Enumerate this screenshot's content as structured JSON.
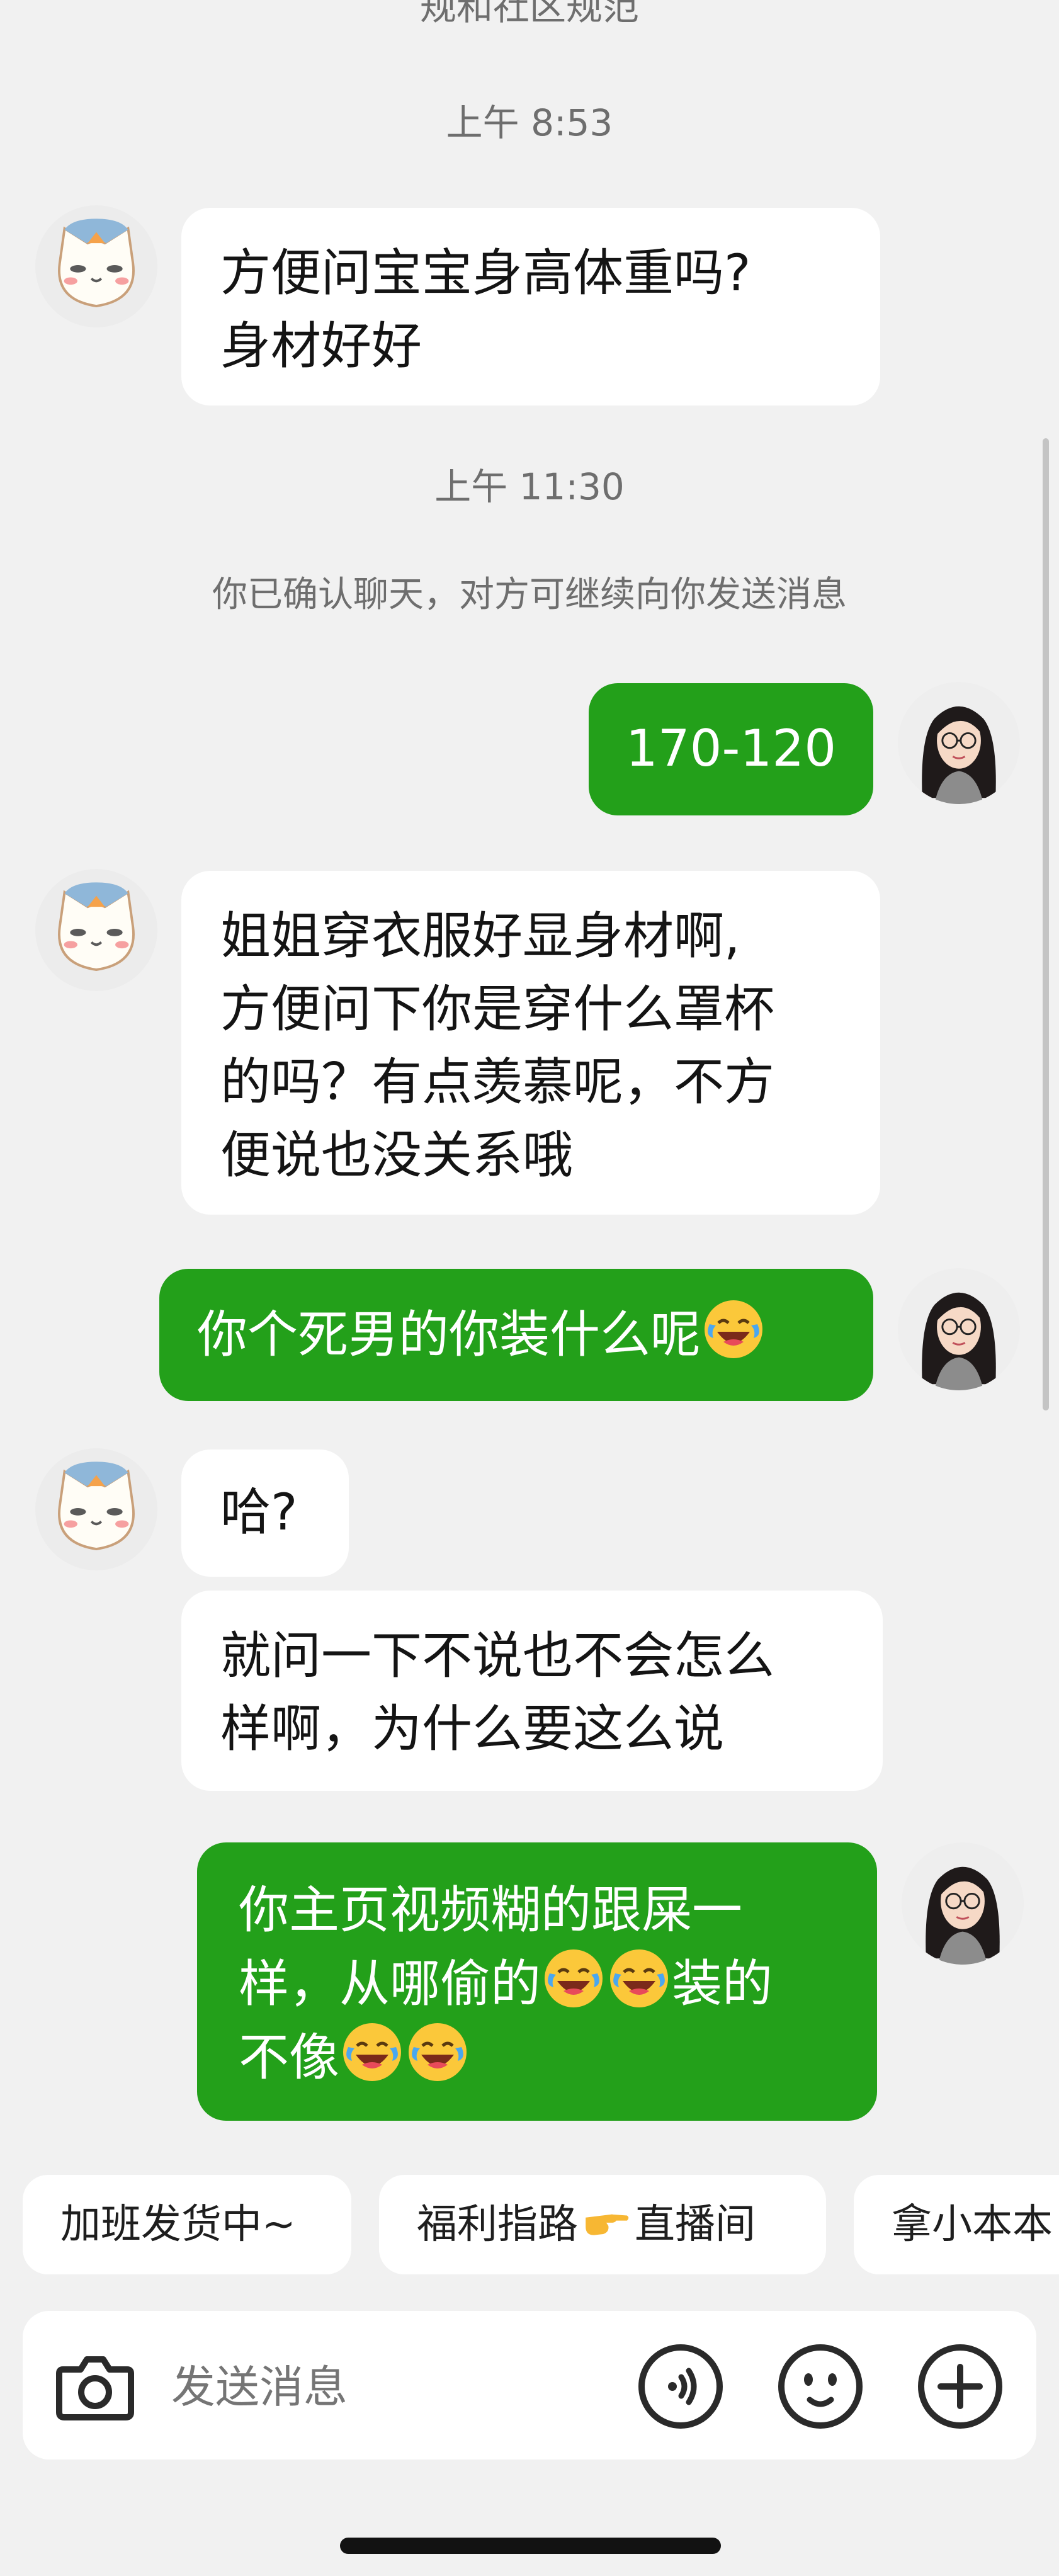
{
  "header": {
    "partial_text": "规和社区规范"
  },
  "timestamps": [
    "上午 8:53",
    "上午 11:30"
  ],
  "system_notice": "你已确认聊天，对方可继续向你发送消息",
  "messages": [
    {
      "sender": "other",
      "lines": [
        "方便问宝宝身高体重吗?",
        "身材好好"
      ]
    },
    {
      "sender": "self",
      "lines": [
        "170-120"
      ]
    },
    {
      "sender": "other",
      "lines": [
        "姐姐穿衣服好显身材啊,",
        "方便问下你是穿什么罩杯",
        "的吗？有点羡慕呢，不方",
        "便说也没关系哦"
      ]
    },
    {
      "sender": "self",
      "lines": [
        "你个死男的你装什么呢"
      ]
    },
    {
      "sender": "other",
      "lines": [
        "哈?"
      ]
    },
    {
      "sender": "other",
      "lines": [
        "就问一下不说也不会怎么",
        "样啊，为什么要这么说"
      ]
    },
    {
      "sender": "self",
      "lines": [
        "你主页视频糊的跟屎一",
        "样，从哪偷的",
        "装的",
        "不像"
      ]
    }
  ],
  "quick_replies": [
    "加班发货中~",
    "福利指路",
    "直播间",
    "拿小本本"
  ],
  "input": {
    "placeholder": "发送消息"
  },
  "icons": {
    "other_avatar": "cat-avatar-icon",
    "self_avatar": "girl-glasses-avatar-icon",
    "emoji": "laughing-crying-emoji-icon",
    "hand": "pointing-hand-emoji-icon",
    "camera": "camera-icon",
    "voice": "voice-icon",
    "sticker": "smiley-icon",
    "plus": "plus-icon"
  },
  "colors": {
    "self_bubble": "#23a01a",
    "other_bubble": "#ffffff",
    "background": "#f1f1f1"
  }
}
